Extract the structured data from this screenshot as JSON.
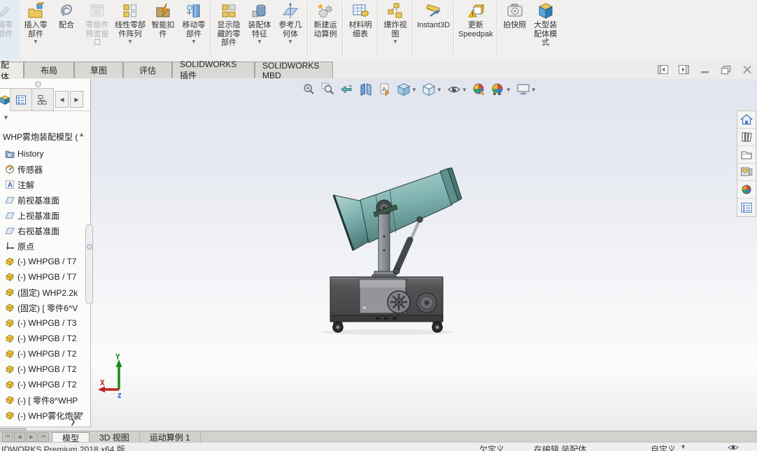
{
  "ribbon": {
    "buttons": [
      {
        "name": "edit-component",
        "label": "辑零\n部件",
        "disabled": true,
        "caret": false
      },
      {
        "name": "insert-components",
        "label": "插入零\n部件",
        "disabled": false,
        "caret": true
      },
      {
        "name": "mate",
        "label": "配合",
        "disabled": false,
        "caret": false
      },
      {
        "name": "component-preview-window",
        "label": "零部件\n预览窗\n口",
        "disabled": true,
        "caret": false
      },
      {
        "name": "linear-component-pattern",
        "label": "线性零部\n件阵列",
        "disabled": false,
        "caret": true
      },
      {
        "name": "smart-fasteners",
        "label": "智能扣\n件",
        "disabled": false,
        "caret": false
      },
      {
        "name": "move-component",
        "label": "移动零\n部件",
        "disabled": false,
        "caret": true
      },
      {
        "name": "show-hidden-components",
        "label": "显示隐\n藏的零\n部件",
        "disabled": false,
        "caret": false
      },
      {
        "name": "assembly-features",
        "label": "装配体\n特征",
        "disabled": false,
        "caret": true
      },
      {
        "name": "reference-geometry",
        "label": "参考几\n何体",
        "disabled": false,
        "caret": true
      },
      {
        "name": "new-motion-study",
        "label": "新建运\n动算例",
        "disabled": false,
        "caret": false
      },
      {
        "name": "bill-of-materials",
        "label": "材料明\n细表",
        "disabled": false,
        "caret": false
      },
      {
        "name": "exploded-view",
        "label": "爆炸视\n图",
        "disabled": false,
        "caret": true
      },
      {
        "name": "instant3d",
        "label": "Instant3D",
        "disabled": false,
        "caret": false
      },
      {
        "name": "update-speedpak",
        "label": "更新\nSpeedpak",
        "disabled": false,
        "caret": false
      },
      {
        "name": "take-snapshot",
        "label": "拍快照",
        "disabled": false,
        "caret": false
      },
      {
        "name": "large-assembly-mode",
        "label": "大型装\n配体模\n式",
        "disabled": false,
        "caret": false
      }
    ]
  },
  "command_tabs": [
    "配体",
    "布局",
    "草图",
    "评估",
    "SOLIDWORKS 插件",
    "SOLIDWORKS MBD"
  ],
  "feature_tree": {
    "root": "WHP雾炮装配模型 (",
    "items": [
      {
        "icon": "history-icon",
        "label": "History"
      },
      {
        "icon": "sensors-icon",
        "label": "传感器"
      },
      {
        "icon": "annotations-icon",
        "label": "注解"
      },
      {
        "icon": "plane-icon",
        "label": "前视基准面"
      },
      {
        "icon": "plane-icon",
        "label": "上视基准面"
      },
      {
        "icon": "plane-icon",
        "label": "右视基准面"
      },
      {
        "icon": "origin-icon",
        "label": "原点"
      },
      {
        "icon": "part-icon",
        "label": "(-) WHPGB / T7"
      },
      {
        "icon": "part-icon",
        "label": "(-) WHPGB / T7"
      },
      {
        "icon": "part-icon",
        "label": "(固定) WHP2.2k"
      },
      {
        "icon": "part-icon",
        "label": "(固定) [ 零件6^V"
      },
      {
        "icon": "part-icon",
        "label": "(-) WHPGB / T3"
      },
      {
        "icon": "part-icon",
        "label": "(-) WHPGB / T2"
      },
      {
        "icon": "part-icon",
        "label": "(-) WHPGB / T2"
      },
      {
        "icon": "part-icon",
        "label": "(-) WHPGB / T2"
      },
      {
        "icon": "part-icon",
        "label": "(-) WHPGB / T2"
      },
      {
        "icon": "part-icon",
        "label": "(-) [ 零件8^WHP"
      },
      {
        "icon": "part-icon",
        "label": "(-) WHP雾化炮装"
      }
    ]
  },
  "headsup_icons": [
    "zoom-to-fit",
    "zoom-to-area",
    "previous-view",
    "section-view",
    "hide-annotations",
    "view-orientation",
    "display-style",
    "hide-show-items",
    "edit-appearance",
    "apply-scene",
    "view-settings"
  ],
  "taskpane_icons": [
    "home",
    "design-library",
    "file-explorer",
    "view-palette",
    "appearances",
    "custom-properties"
  ],
  "triad": {
    "x": "X",
    "y": "Y",
    "z": "Z"
  },
  "bottom_tabs": [
    "模型",
    "3D 视图",
    "运动算例 1"
  ],
  "status": {
    "left": "IDWORKS Premium 2018 x64 版",
    "state": "欠定义",
    "editing": "在编辑 装配体",
    "custom": "自定义"
  },
  "colors": {
    "barrel": "#7fb3b0",
    "barrel_dark": "#4e8280",
    "base_box": "#4f5052",
    "viewport_top": "#e2e5ee",
    "viewport_bottom": "#fbfbfb",
    "part_icon": "#ecc94b"
  }
}
